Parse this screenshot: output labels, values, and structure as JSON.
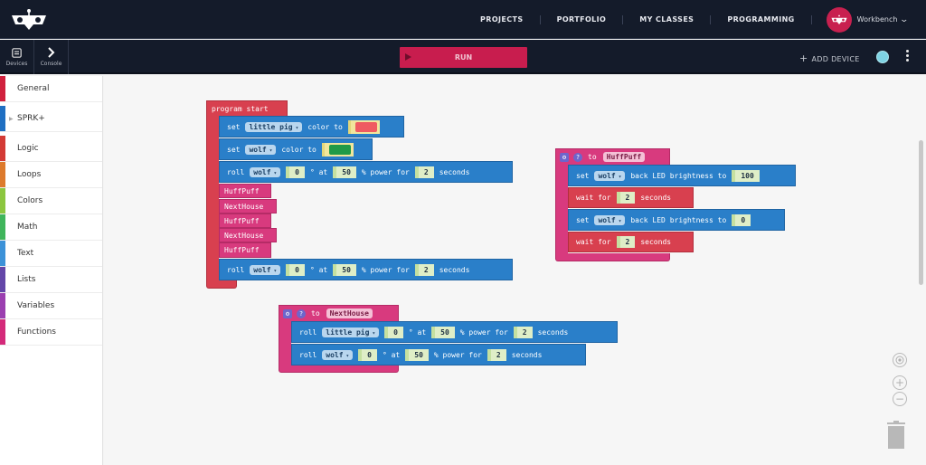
{
  "header": {
    "logo": "robot-logo",
    "nav": [
      "PROJECTS",
      "PORTFOLIO",
      "MY CLASSES",
      "PROGRAMMING"
    ],
    "user": {
      "name": "Workbench",
      "avatar_color": "#c8204f"
    }
  },
  "toolbar": {
    "devices_label": "Devices",
    "console_label": "Console",
    "run_label": "RUN",
    "add_device_label": "ADD DEVICE",
    "status_color": "#7ed3e4"
  },
  "sidebar": {
    "categories": [
      {
        "label": "General",
        "color": "#d0213d"
      },
      {
        "label": "SPRK+",
        "color": "#1f6fc2",
        "expandable": true
      },
      {
        "label": "Logic",
        "color": "#d33a35"
      },
      {
        "label": "Loops",
        "color": "#dd7a2c"
      },
      {
        "label": "Colors",
        "color": "#8cc63f"
      },
      {
        "label": "Math",
        "color": "#3fb55b"
      },
      {
        "label": "Text",
        "color": "#3c92d8"
      },
      {
        "label": "Lists",
        "color": "#6346a8"
      },
      {
        "label": "Variables",
        "color": "#9b3fb0"
      },
      {
        "label": "Functions",
        "color": "#d42a7a"
      }
    ]
  },
  "blocks": {
    "program_start": {
      "header": "program start",
      "set_pig_color": {
        "verb": "set",
        "target": "little pig",
        "text": "color to",
        "color": "#ef5b61"
      },
      "set_wolf_color": {
        "verb": "set",
        "target": "wolf",
        "text": "color to",
        "color": "#1f9a47"
      },
      "roll1": {
        "verb": "roll",
        "target": "wolf",
        "heading": "0",
        "at": "° at",
        "power": "50",
        "power_for": "% power for",
        "duration": "2",
        "unit": "seconds"
      },
      "calls": [
        "HuffPuff",
        "NextHouse",
        "HuffPuff",
        "NextHouse",
        "HuffPuff"
      ],
      "roll2": {
        "verb": "roll",
        "target": "wolf",
        "heading": "0",
        "at": "° at",
        "power": "50",
        "power_for": "% power for",
        "duration": "2",
        "unit": "seconds"
      }
    },
    "huffpuff": {
      "to": "to",
      "name": "HuffPuff",
      "set1": {
        "verb": "set",
        "target": "wolf",
        "text": "back LED brightness to",
        "value": "100"
      },
      "wait1": {
        "text": "wait for",
        "value": "2",
        "unit": "seconds"
      },
      "set2": {
        "verb": "set",
        "target": "wolf",
        "text": "back LED brightness to",
        "value": "0"
      },
      "wait2": {
        "text": "wait for",
        "value": "2",
        "unit": "seconds"
      }
    },
    "nexthouse": {
      "to": "to",
      "name": "NextHouse",
      "roll1": {
        "verb": "roll",
        "target": "little pig",
        "heading": "0",
        "at": "° at",
        "power": "50",
        "power_for": "% power for",
        "duration": "2",
        "unit": "seconds"
      },
      "roll2": {
        "verb": "roll",
        "target": "wolf",
        "heading": "0",
        "at": "° at",
        "power": "50",
        "power_for": "% power for",
        "duration": "2",
        "unit": "seconds"
      }
    }
  },
  "controls": {
    "recenter": "recenter-icon",
    "zoom_in": "+",
    "zoom_out": "−",
    "trash": "trash-icon"
  }
}
